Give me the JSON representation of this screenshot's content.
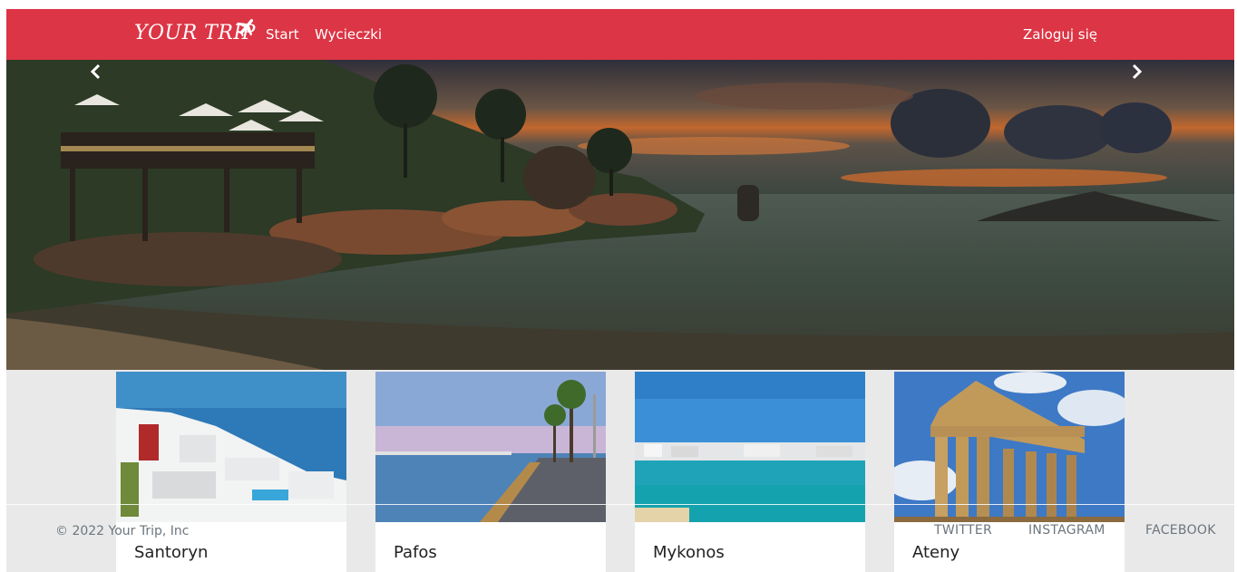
{
  "navbar": {
    "brand": "YOUR TRIP",
    "links": [
      "Start",
      "Wycieczki"
    ],
    "login": "Zaloguj się"
  },
  "hero": {
    "prev_icon": "chevron-left-icon",
    "next_icon": "chevron-right-icon"
  },
  "cards": [
    {
      "title": "Santoryn"
    },
    {
      "title": "Pafos"
    },
    {
      "title": "Mykonos"
    },
    {
      "title": "Ateny"
    }
  ],
  "footer": {
    "copyright": "© 2022 Your Trip, Inc",
    "links": [
      "TWITTER",
      "INSTAGRAM",
      "FACEBOOK"
    ]
  },
  "colors": {
    "navbar": "#dc3545",
    "cards_bg": "#e9e9e9",
    "footer_text": "#6c757d"
  }
}
